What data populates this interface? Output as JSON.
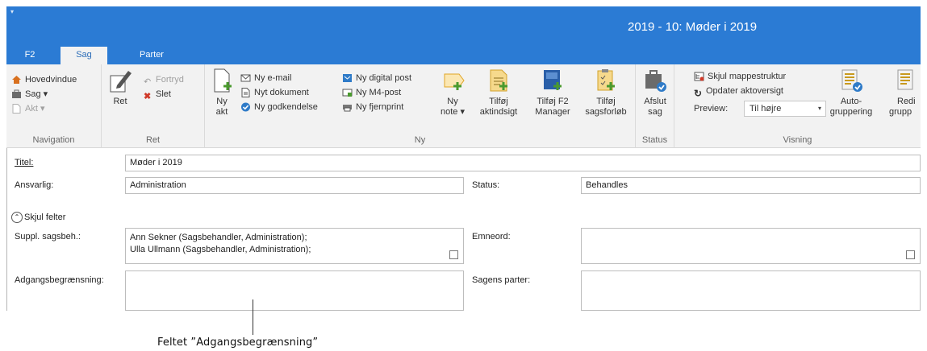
{
  "window": {
    "title": "2019 - 10: Møder i 2019",
    "quick_access": "▾"
  },
  "tabs": [
    {
      "label": "F2"
    },
    {
      "label": "Sag"
    },
    {
      "label": "Parter"
    }
  ],
  "ribbon": {
    "navigation": {
      "label": "Navigation",
      "items": [
        "Hovedvindue",
        "Sag ▾",
        "Akt ▾"
      ]
    },
    "ret": {
      "label": "Ret",
      "ret_button": "Ret",
      "undo": "Fortryd",
      "delete": "Slet"
    },
    "ny": {
      "label": "Ny",
      "ny_akt": [
        "Ny",
        "akt"
      ],
      "ny_email": "Ny e-mail",
      "nyt_dokument": "Nyt dokument",
      "ny_godkendelse": "Ny godkendelse",
      "ny_digital_post": "Ny digital post",
      "ny_m4_post": "Ny M4-post",
      "ny_fjernprint": "Ny fjernprint",
      "ny_note": [
        "Ny",
        "note ▾"
      ],
      "tilfoej_aktindsigt": [
        "Tilføj",
        "aktindsigt"
      ],
      "tilfoej_f2_manager": [
        "Tilføj F2",
        "Manager"
      ],
      "tilfoej_sagsforloeb": [
        "Tilføj",
        "sagsforløb"
      ]
    },
    "status": {
      "label": "Status",
      "afslut_sag": [
        "Afslut",
        "sag"
      ]
    },
    "visning": {
      "label": "Visning",
      "skjul_mappestruktur": "Skjul mappestruktur",
      "opdater_aktoversigt": "Opdater aktoversigt",
      "preview_label": "Preview:",
      "preview_value": "Til højre",
      "autogruppering": [
        "Auto-",
        "gruppering"
      ],
      "redigeret_gruppering": [
        "Redi",
        "grupp"
      ]
    }
  },
  "form": {
    "titel_label": "Titel:",
    "titel_value": "Møder i 2019",
    "ansvarlig_label": "Ansvarlig:",
    "ansvarlig_value": "Administration",
    "status_label": "Status:",
    "status_value": "Behandles",
    "skjul_felter": "Skjul felter",
    "suppl_label": "Suppl. sagsbeh.:",
    "suppl_values": [
      "Ann Sekner (Sagsbehandler, Administration);",
      "Ulla Ullmann (Sagsbehandler, Administration);"
    ],
    "emneord_label": "Emneord:",
    "emneord_value": "",
    "adgang_label": "Adgangsbegrænsning:",
    "adgang_value": "",
    "parter_label": "Sagens parter:",
    "parter_value": ""
  },
  "annotation": "Feltet ”Adgangsbegrænsning”",
  "colors": {
    "accent": "#2b7bd4",
    "ribbon_bg": "#f2f2f2",
    "tab_active_text": "#2b6cb8"
  }
}
